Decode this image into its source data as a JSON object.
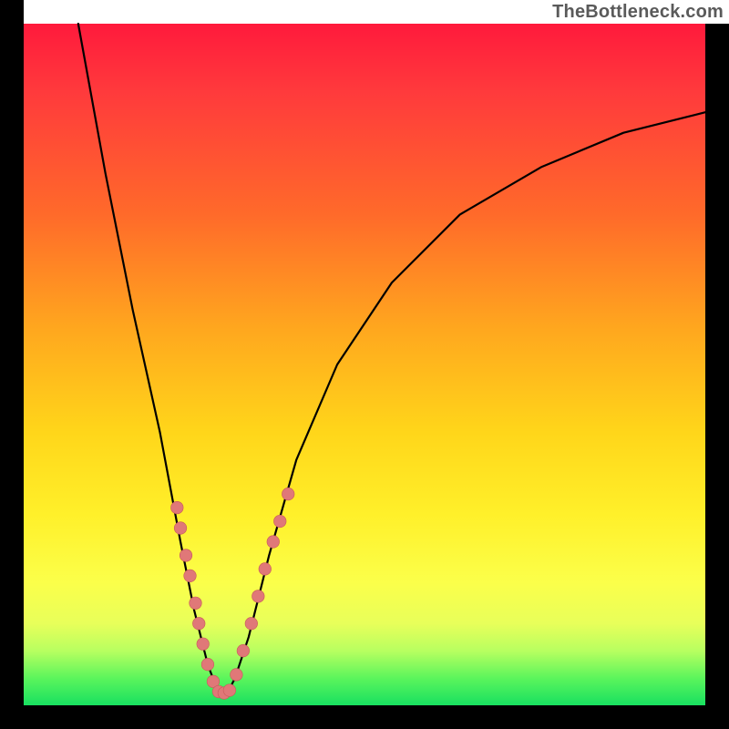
{
  "watermark": "TheBottleneck.com",
  "colors": {
    "frame": "#000000",
    "gradient_top": "#ff1a3c",
    "gradient_mid": "#ffd61a",
    "gradient_bottom": "#18e060",
    "curve": "#000000",
    "dots_fill": "#e07878",
    "dots_stroke": "#c85a5a"
  },
  "chart_data": {
    "type": "line",
    "title": "",
    "xlabel": "",
    "ylabel": "",
    "xlim": [
      0,
      100
    ],
    "ylim": [
      0,
      100
    ],
    "note": "axes not labeled; values estimated from pixel positions (0–100)",
    "series": [
      {
        "name": "bottleneck-curve",
        "x": [
          8,
          12,
          16,
          20,
          23,
          25,
          27,
          28.5,
          30,
          31,
          33,
          36,
          40,
          46,
          54,
          64,
          76,
          88,
          100
        ],
        "y": [
          100,
          78,
          58,
          40,
          24,
          14,
          6,
          2,
          2,
          4,
          10,
          22,
          36,
          50,
          62,
          72,
          79,
          84,
          87
        ]
      }
    ],
    "markers": [
      {
        "series": "bottleneck-curve",
        "x": 22.5,
        "y": 29
      },
      {
        "series": "bottleneck-curve",
        "x": 23.0,
        "y": 26
      },
      {
        "series": "bottleneck-curve",
        "x": 23.8,
        "y": 22
      },
      {
        "series": "bottleneck-curve",
        "x": 24.4,
        "y": 19
      },
      {
        "series": "bottleneck-curve",
        "x": 25.2,
        "y": 15
      },
      {
        "series": "bottleneck-curve",
        "x": 25.7,
        "y": 12
      },
      {
        "series": "bottleneck-curve",
        "x": 26.3,
        "y": 9
      },
      {
        "series": "bottleneck-curve",
        "x": 27.0,
        "y": 6
      },
      {
        "series": "bottleneck-curve",
        "x": 27.8,
        "y": 3.5
      },
      {
        "series": "bottleneck-curve",
        "x": 28.6,
        "y": 2
      },
      {
        "series": "bottleneck-curve",
        "x": 29.4,
        "y": 1.8
      },
      {
        "series": "bottleneck-curve",
        "x": 30.2,
        "y": 2.2
      },
      {
        "series": "bottleneck-curve",
        "x": 31.2,
        "y": 4.5
      },
      {
        "series": "bottleneck-curve",
        "x": 32.2,
        "y": 8
      },
      {
        "series": "bottleneck-curve",
        "x": 33.4,
        "y": 12
      },
      {
        "series": "bottleneck-curve",
        "x": 34.4,
        "y": 16
      },
      {
        "series": "bottleneck-curve",
        "x": 35.4,
        "y": 20
      },
      {
        "series": "bottleneck-curve",
        "x": 36.6,
        "y": 24
      },
      {
        "series": "bottleneck-curve",
        "x": 37.6,
        "y": 27
      },
      {
        "series": "bottleneck-curve",
        "x": 38.8,
        "y": 31
      }
    ]
  }
}
